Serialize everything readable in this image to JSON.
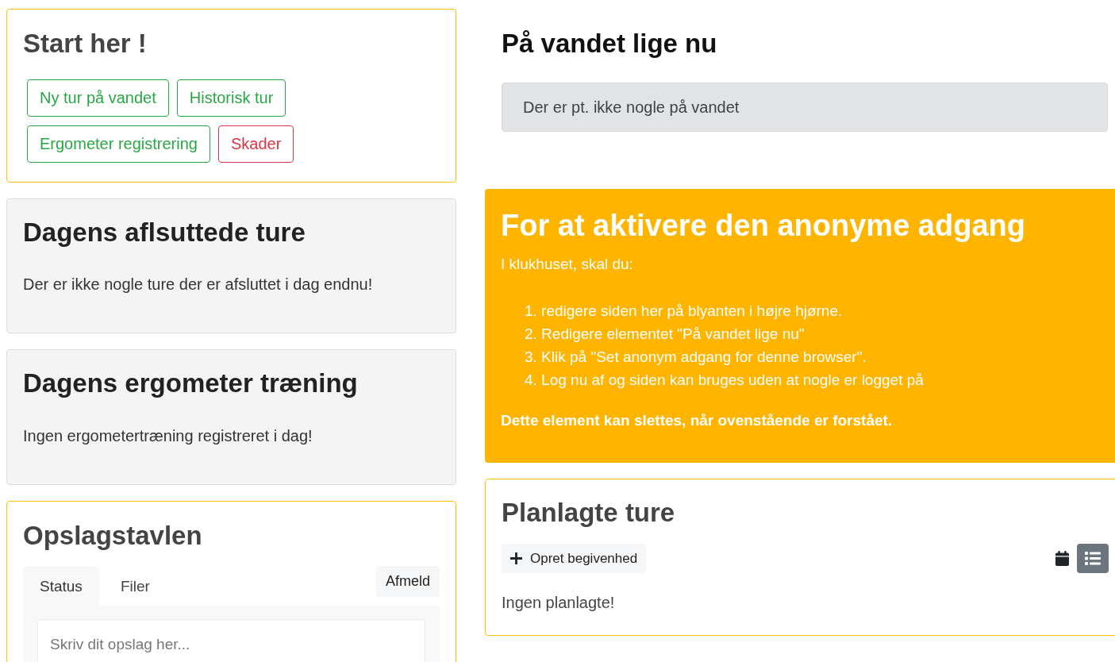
{
  "start_card": {
    "title": "Start her !",
    "buttons": [
      {
        "label": "Ny tur på vandet",
        "kind": "success"
      },
      {
        "label": "Historisk tur",
        "kind": "success"
      },
      {
        "label": "Ergometer registrering",
        "kind": "success"
      },
      {
        "label": "Skader",
        "kind": "danger"
      }
    ]
  },
  "finished_trips": {
    "title": "Dagens aflsuttede ture",
    "message": "Der er ikke nogle ture der er afsluttet i dag endnu!"
  },
  "ergometer_training": {
    "title": "Dagens ergometer træning",
    "message": "Ingen ergometertræning registreret i dag!"
  },
  "notice_board": {
    "title": "Opslagstavlen",
    "tabs": [
      {
        "label": "Status",
        "selected": true
      },
      {
        "label": "Filer",
        "selected": false
      }
    ],
    "unsubscribe_button": "Afmeld",
    "post_field": {
      "placeholder": "Skriv dit opslag her..."
    }
  },
  "on_water": {
    "title": "På vandet lige nu",
    "message": "Der er pt. ikke nogle på vandet"
  },
  "anonymous_access": {
    "title": "For at aktivere den anonyme adgang",
    "intro": "I klukhuset, skal du:",
    "steps": [
      "1. redigere siden her på blyanten i højre hjørne.",
      "2. Redigere elementet \"På vandet lige nu\"",
      "3. Klik på \"Set anonym adgang for denne browser\".",
      "4. Log nu af og siden kan bruges uden at nogle er logget på"
    ],
    "note": "Dette element kan slettes, når ovenstående er forstået."
  },
  "planned_trips": {
    "title": "Planlagte ture",
    "create_button": "Opret begivenhed",
    "views": [
      {
        "kind": "calendar",
        "selected": false
      },
      {
        "kind": "list",
        "selected": true
      }
    ],
    "message": "Ingen planlagte!"
  }
}
